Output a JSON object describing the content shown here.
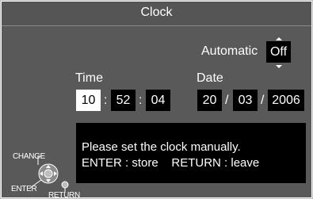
{
  "title": "Clock",
  "automatic": {
    "label": "Automatic",
    "value": "Off"
  },
  "time": {
    "label": "Time",
    "hour": "10",
    "minute": "52",
    "second": "04",
    "separator": ":"
  },
  "date": {
    "label": "Date",
    "day": "20",
    "month": "03",
    "year": "2006",
    "separator": "/"
  },
  "message": {
    "line1": "Please set the clock manually.",
    "line2": "ENTER : store    RETURN : leave"
  },
  "controls": {
    "change": "CHANGE",
    "enter": "ENTER",
    "return": "RETURN"
  },
  "colors": {
    "title_bar": "#555555",
    "panel": "#595959",
    "field_bg": "#000000",
    "selected_bg": "#ffffff"
  },
  "icons": {
    "dpad": "dpad-icon",
    "return": "return-button-icon",
    "spinner": "up-down-arrows-icon"
  }
}
